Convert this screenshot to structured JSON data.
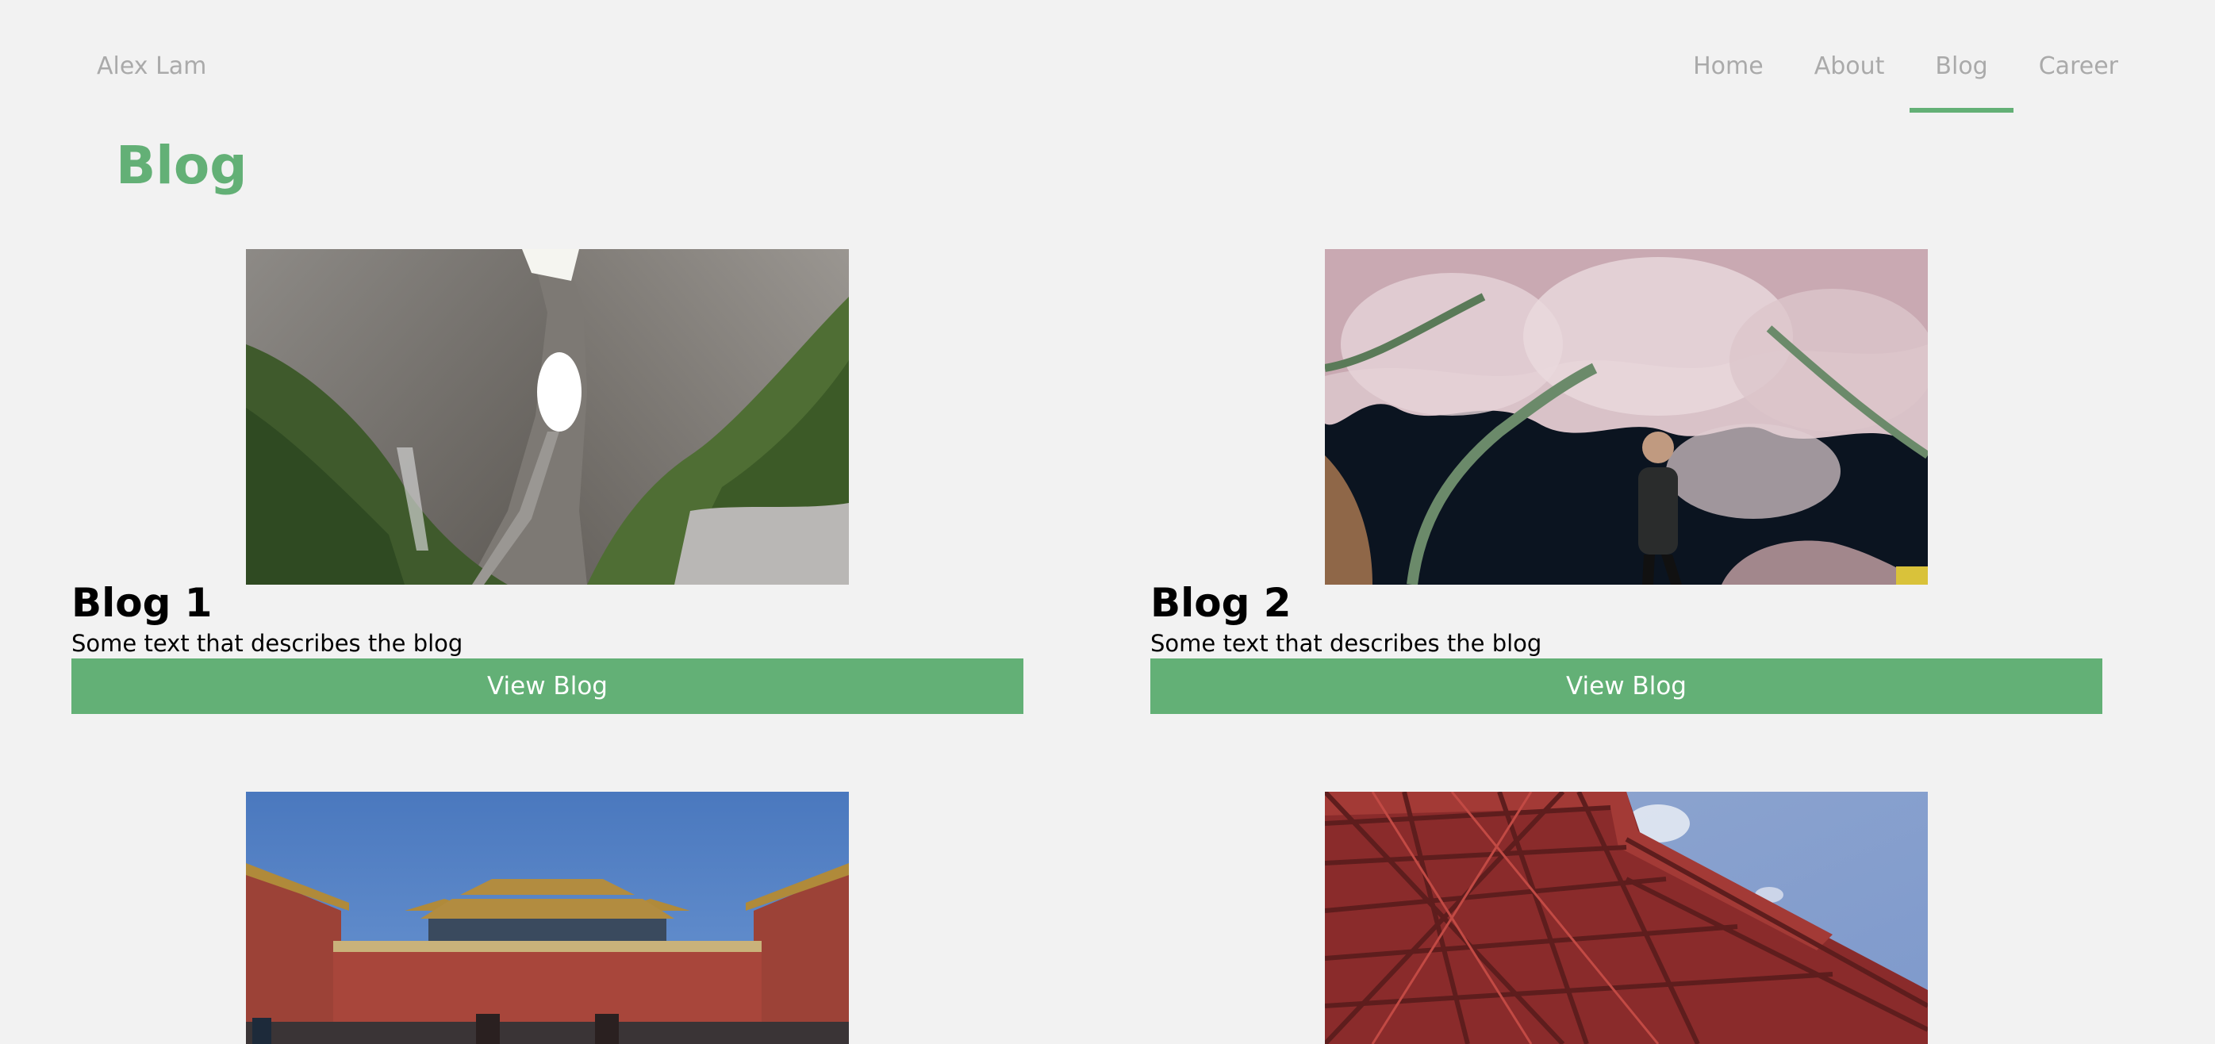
{
  "nav": {
    "brand": "Alex Lam",
    "links": [
      {
        "label": "Home",
        "active": false
      },
      {
        "label": "About",
        "active": false
      },
      {
        "label": "Blog",
        "active": true
      },
      {
        "label": "Career",
        "active": false
      }
    ]
  },
  "page": {
    "title": "Blog"
  },
  "blogs": [
    {
      "title": "Blog 1",
      "description": "Some text that describes the blog",
      "button": "View Blog",
      "image": "mountain-arch-photo"
    },
    {
      "title": "Blog 2",
      "description": "Some text that describes the blog",
      "button": "View Blog",
      "image": "cherry-blossom-night-photo"
    },
    {
      "title": "",
      "description": "",
      "button": "",
      "image": "palace-gate-photo"
    },
    {
      "title": "",
      "description": "",
      "button": "",
      "image": "red-tower-photo"
    }
  ],
  "colors": {
    "accent": "#63b076",
    "background": "#f2f2f2",
    "nav_text": "#aaaaaa"
  }
}
